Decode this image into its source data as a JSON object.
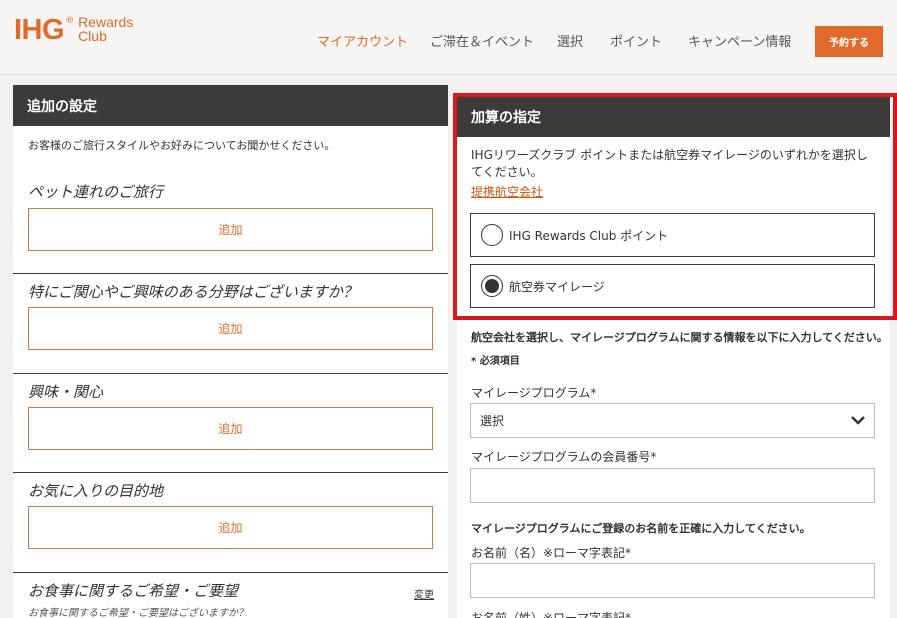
{
  "header": {
    "logo_text": "IHG",
    "logo_reg": "®",
    "logo_sub1": "Rewards",
    "logo_sub2": "Club",
    "nav": [
      {
        "label": "マイアカウント",
        "active": true
      },
      {
        "label": "ご滞在＆イベント",
        "active": false
      },
      {
        "label": "選択",
        "active": false
      },
      {
        "label": "ポイント",
        "active": false
      },
      {
        "label": "キャンペーン情報",
        "active": false
      }
    ],
    "book_button": "予約する"
  },
  "left_panel": {
    "title": "追加の設定",
    "intro": "お客様のご旅行スタイルやお好みについてお聞かせください。",
    "sections": [
      {
        "title": "ペット連れのご旅行",
        "button": "追加"
      },
      {
        "title": "特にご関心やご興味のある分野はございますか？",
        "button": "追加"
      },
      {
        "title": "興味・関心",
        "button": "追加"
      },
      {
        "title": "お気に入りの目的地",
        "button": "追加"
      },
      {
        "title": "お食事に関するご希望・ご要望"
      }
    ],
    "change_link": "変更",
    "meal_question": "お食事に関するご希望・ご要望はございますか？"
  },
  "right_panel": {
    "title": "加算の指定",
    "intro": "IHGリワーズクラブ ポイントまたは航空券マイレージのいずれかを選択してください。",
    "partner_link": "提携航空会社",
    "options": [
      {
        "label": "IHG Rewards Club ポイント",
        "selected": false
      },
      {
        "label": "航空券マイレージ",
        "selected": true
      }
    ],
    "instruction": "航空会社を選択し、マイレージプログラムに関する情報を以下に入力してください。",
    "required_note": "* 必須項目",
    "program_label": "マイレージプログラム*",
    "program_value": "選択",
    "member_number_label": "マイレージプログラムの会員番号*",
    "name_instruction": "マイレージプログラムにご登録のお名前を正確に入力してください。",
    "first_name_label": "お名前（名）※ローマ字表記*",
    "last_name_label": "お名前（姓）※ローマ字表記*"
  }
}
